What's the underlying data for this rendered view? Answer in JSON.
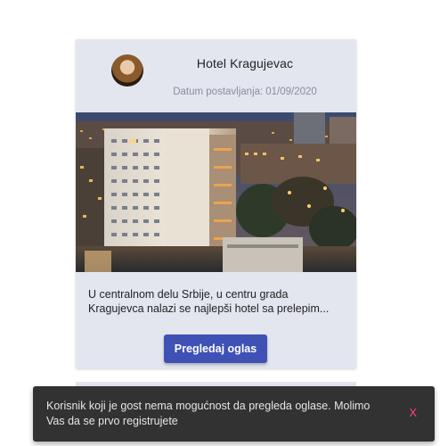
{
  "card": {
    "title": "Hotel Kragujevac",
    "date_label": "Datum postavljanja:",
    "date_value": "01/09/2020",
    "description_lines": [
      "U centralnom delu Srbije, u centru grada",
      "Kragujevca nalazi se najlepši hotel sa prelepim..."
    ],
    "button_label": "Pregledaj oglas"
  },
  "snackbar": {
    "message_lines": [
      "Korisnik koji je gost nema mogućnost da pregleda oglase. Molimo",
      "Vas da se prvo registrujete"
    ],
    "close_label": "X"
  },
  "colors": {
    "primary": "#3f51b5",
    "card_bg": "#e3e6ef",
    "snackbar_bg": "#323232",
    "snackbar_action": "#ff4081"
  }
}
